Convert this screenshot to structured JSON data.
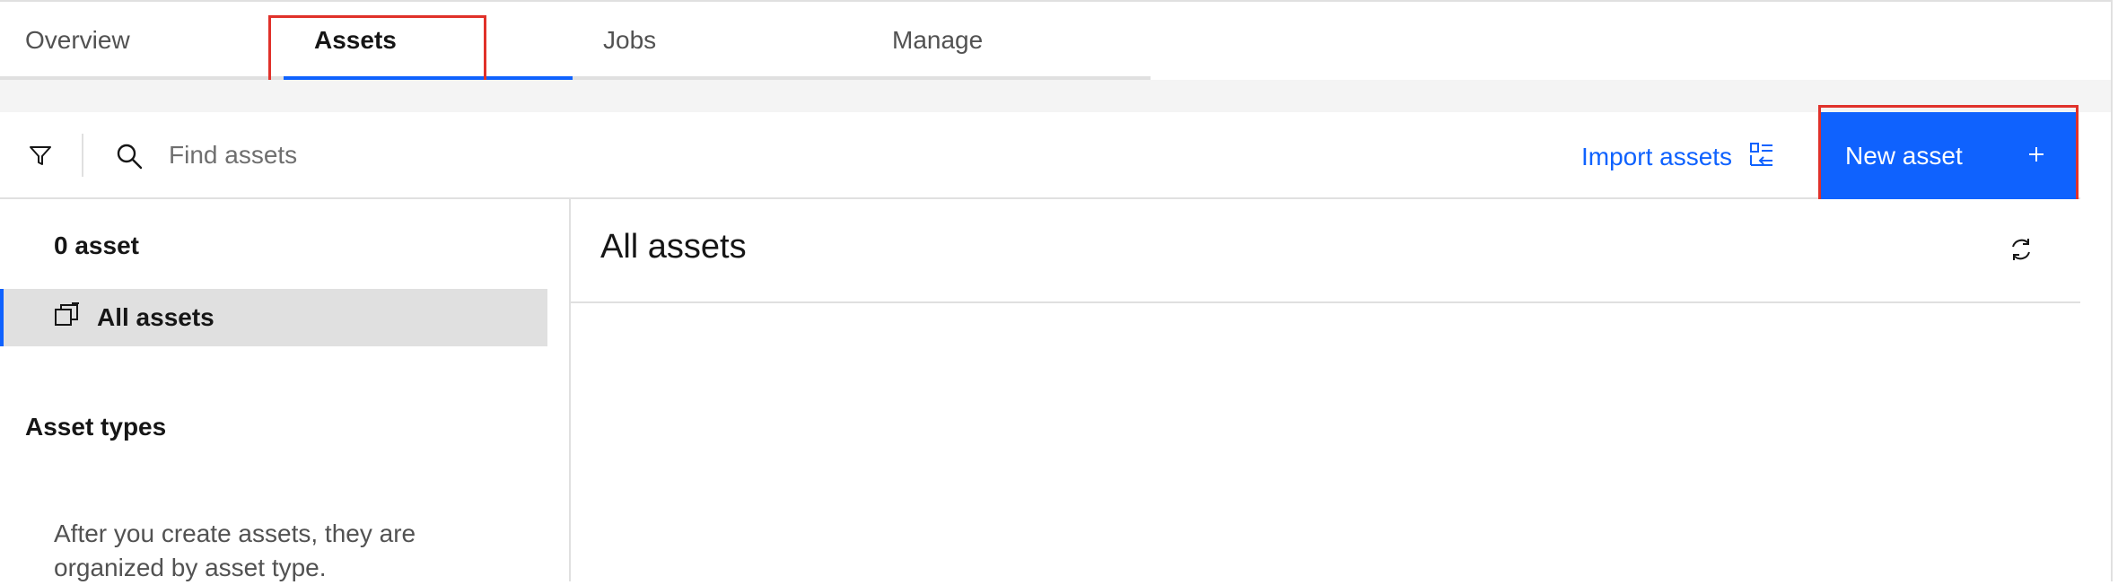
{
  "tabs": [
    {
      "label": "Overview"
    },
    {
      "label": "Assets"
    },
    {
      "label": "Jobs"
    },
    {
      "label": "Manage"
    }
  ],
  "toolbar": {
    "search_placeholder": "Find assets",
    "import_label": "Import assets",
    "new_asset_label": "New asset",
    "new_asset_icon": "plus-icon"
  },
  "left_panel": {
    "asset_count": "0 asset",
    "nav_item_label": "All assets",
    "types_heading": "Asset types",
    "types_empty_text": "After you create assets, they are organized by asset type."
  },
  "main": {
    "title": "All assets"
  },
  "colors": {
    "accent": "#0f62fe",
    "highlight_box": "#e0312a",
    "nav_selected_bg": "#e0e0e0"
  }
}
